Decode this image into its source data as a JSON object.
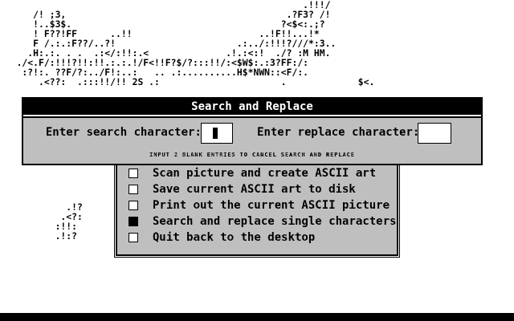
{
  "ascii_art": {
    "lines": [
      "                                                       .!!!/",
      "      /! ;3,                                        .?F3? /!",
      "      !..$3$.                                      ?<$<:.;?",
      "      ! F??!FF      ..!!                       ..!F!!...!*",
      "      F /.:.:F??/..?!                      .:../:!!!?///*:3..",
      "     .H:.:. . .  .:</:!!:.<              .!.:<:!  ./? :M HM.",
      "   ./<.F/:!!!?!!:!!.:.:.!/F<!!F?$/?:::!!/:<$W$:.:3?FF:/:",
      "    :?!:. ??F/?:../F!:..:   .. .:..........H$*NWN::<F/:.",
      "       .<??:  .:::!!/!! 2S .:                      .             $<.",
      "",
      "",
      "",
      "",
      "",
      "",
      "",
      "",
      "",
      "",
      "",
      "",
      "            .!?",
      "           .<?:",
      "          :!!:",
      "          .!:?"
    ]
  },
  "dialog": {
    "title": "Search and Replace",
    "search_label": "Enter search character:",
    "search_value": "",
    "replace_label": "Enter replace character:",
    "replace_value": "",
    "hint": "INPUT 2 BLANK ENTRIES TO CANCEL SEARCH AND REPLACE"
  },
  "menu": {
    "items": [
      {
        "label": "Scan picture and create ASCII art",
        "checked": false
      },
      {
        "label": "Save current ASCII art to disk",
        "checked": false
      },
      {
        "label": "Print out the current ASCII picture",
        "checked": false
      },
      {
        "label": "Search and replace single characters",
        "checked": true
      },
      {
        "label": "Quit back to the desktop",
        "checked": false
      }
    ]
  }
}
